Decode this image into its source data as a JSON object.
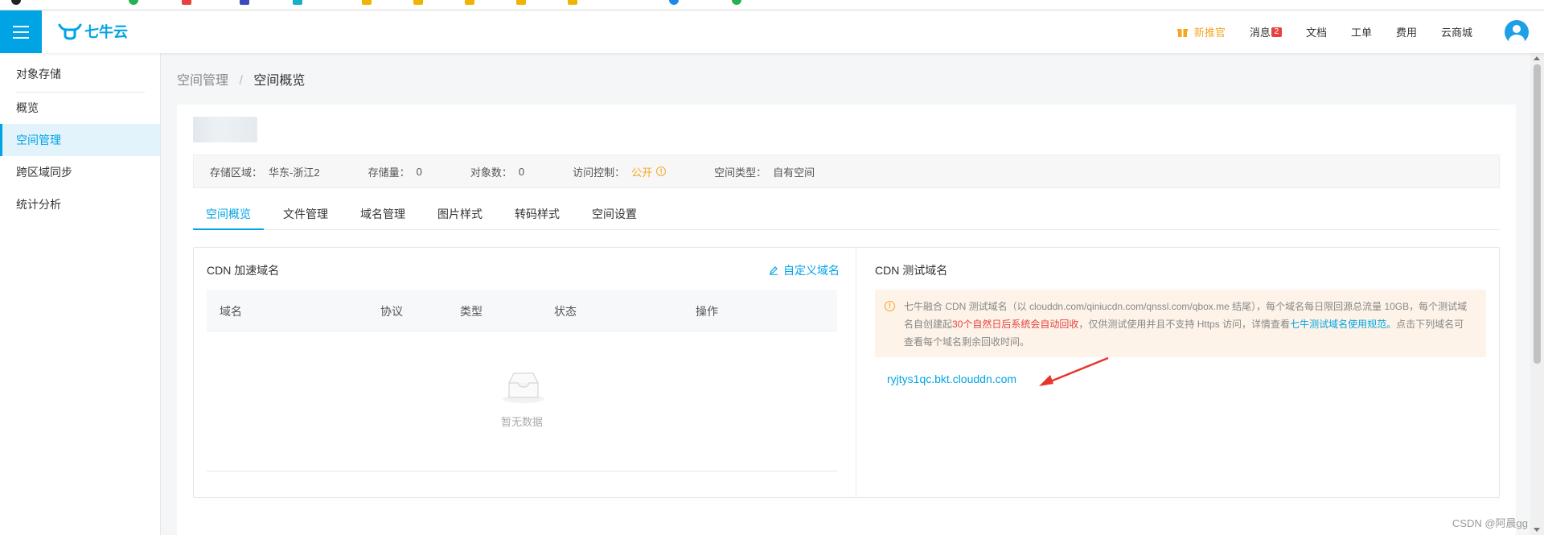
{
  "header": {
    "logo_text": "七牛云",
    "nav": {
      "promo": "新推官",
      "messages": "消息",
      "messages_badge": "2",
      "docs": "文档",
      "tickets": "工单",
      "billing": "费用",
      "marketplace": "云商城"
    }
  },
  "sidebar": {
    "title": "对象存储",
    "items": [
      {
        "label": "概览"
      },
      {
        "label": "空间管理",
        "active": true
      },
      {
        "label": "跨区域同步"
      },
      {
        "label": "统计分析"
      }
    ]
  },
  "breadcrumb": {
    "parent": "空间管理",
    "separator": "/",
    "current": "空间概览"
  },
  "bucket_info": {
    "region_label": "存储区域：",
    "region_value": "华东-浙江2",
    "storage_label": "存储量：",
    "storage_value": "0",
    "objects_label": "对象数：",
    "objects_value": "0",
    "access_label": "访问控制：",
    "access_value": "公开",
    "type_label": "空间类型：",
    "type_value": "自有空间"
  },
  "tabs": [
    {
      "label": "空间概览",
      "active": true
    },
    {
      "label": "文件管理"
    },
    {
      "label": "域名管理"
    },
    {
      "label": "图片样式"
    },
    {
      "label": "转码样式"
    },
    {
      "label": "空间设置"
    }
  ],
  "cdn_domains": {
    "title": "CDN 加速域名",
    "custom_link": "自定义域名",
    "columns": [
      "域名",
      "协议",
      "类型",
      "状态",
      "操作"
    ],
    "empty_text": "暂无数据"
  },
  "cdn_test": {
    "title": "CDN 测试域名",
    "notice_part1": "七牛融合 CDN 测试域名（以 clouddn.com/qiniucdn.com/qnssl.com/qbox.me 结尾），每个域名每日限回源总流量 10GB，每个测试域名自创建起",
    "notice_red": "30个自然日后系统会自动回收",
    "notice_part2": "，仅供测试使用并且不支持 Https 访问，详情查看",
    "notice_link": "七牛测试域名使用规范。",
    "notice_part3": "点击下列域名可查看每个域名剩余回收时间。",
    "domain": "ryjtys1qc.bkt.clouddn.com"
  },
  "watermark": "CSDN @阿晨gg",
  "colors": {
    "primary": "#00a4e4",
    "accent_orange": "#f5a623",
    "alert_red": "#e64340",
    "arrow_red": "#e8332a"
  }
}
